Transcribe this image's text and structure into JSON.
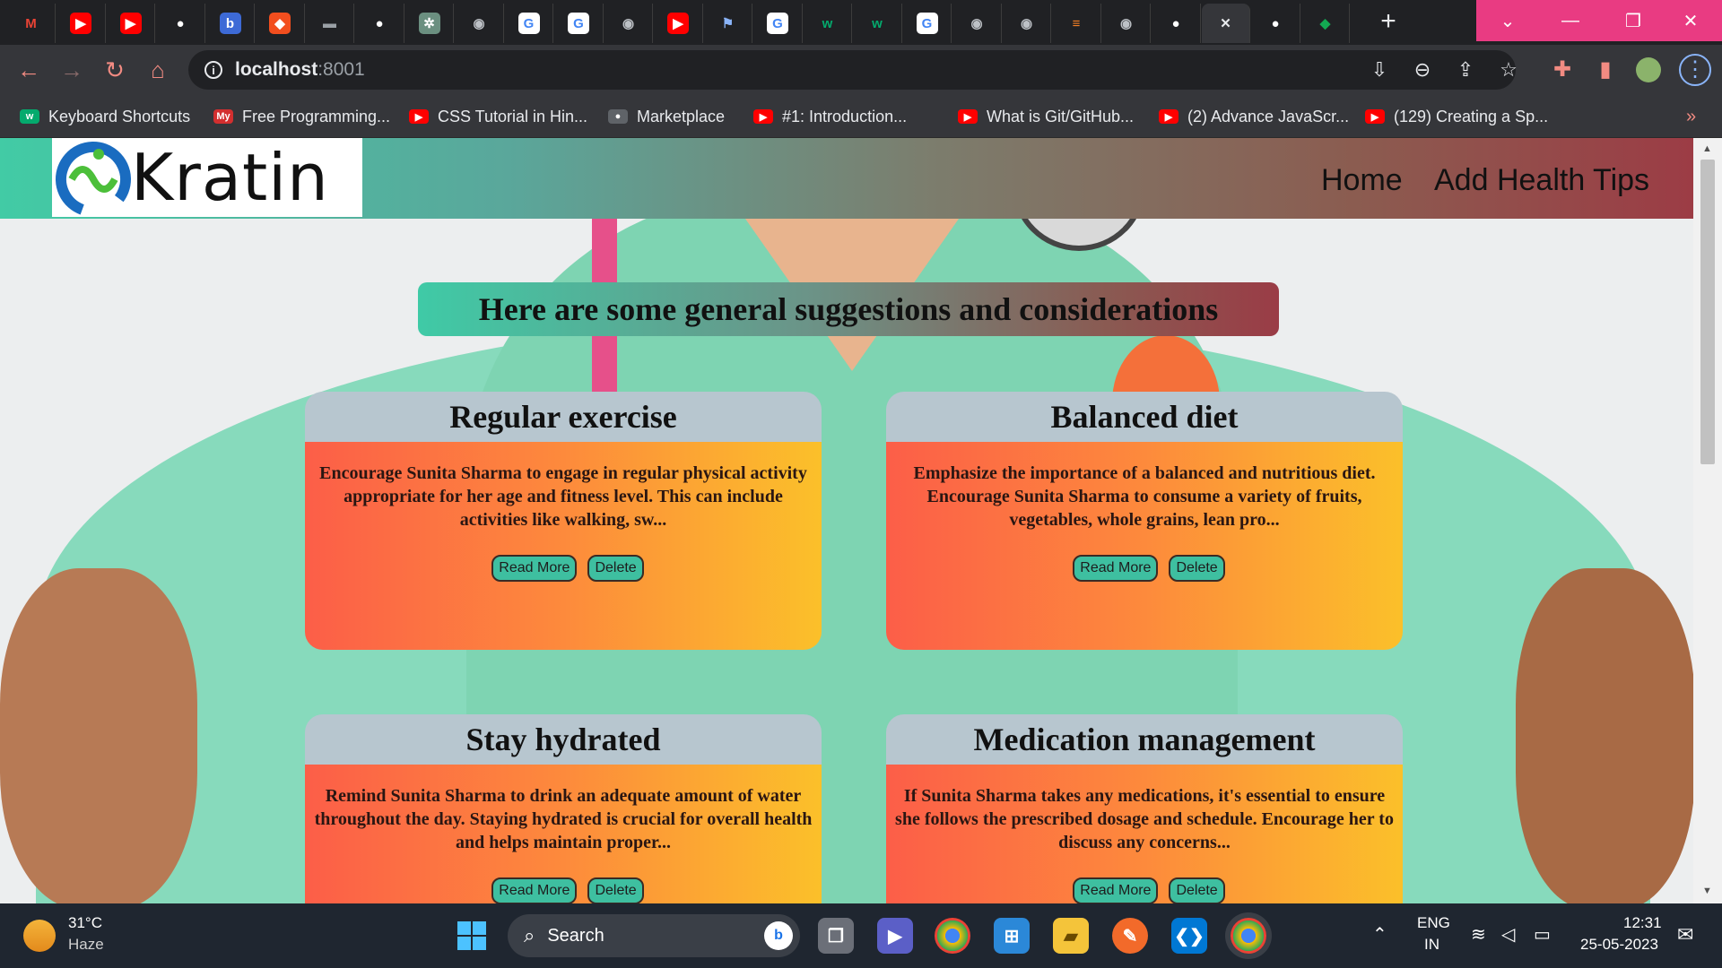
{
  "browser": {
    "tabs": [
      {
        "icon": "gmail-icon",
        "glyph": "M",
        "color": "#ea4335",
        "bg": "transparent"
      },
      {
        "icon": "youtube-icon",
        "glyph": "▶",
        "color": "#fff",
        "bg": "#ff0000"
      },
      {
        "icon": "youtube-icon",
        "glyph": "▶",
        "color": "#fff",
        "bg": "#ff0000"
      },
      {
        "icon": "github-icon",
        "glyph": "●",
        "color": "#fff",
        "bg": "transparent"
      },
      {
        "icon": "docs-icon",
        "glyph": "b",
        "color": "#fff",
        "bg": "#3d6ad6"
      },
      {
        "icon": "figma-icon",
        "glyph": "◆",
        "color": "#fff",
        "bg": "#f24e1e"
      },
      {
        "icon": "dash-icon",
        "glyph": "▬",
        "color": "#9aa0a6",
        "bg": "transparent"
      },
      {
        "icon": "github-icon",
        "glyph": "●",
        "color": "#fff",
        "bg": "transparent"
      },
      {
        "icon": "chatgpt-icon",
        "glyph": "✲",
        "color": "#fff",
        "bg": "#6b8f80"
      },
      {
        "icon": "globe-icon",
        "glyph": "◉",
        "color": "#bdc1c6",
        "bg": "transparent"
      },
      {
        "icon": "google-icon",
        "glyph": "G",
        "color": "#4285f4",
        "bg": "#fff"
      },
      {
        "icon": "google-icon",
        "glyph": "G",
        "color": "#4285f4",
        "bg": "#fff"
      },
      {
        "icon": "globe-icon",
        "glyph": "◉",
        "color": "#bdc1c6",
        "bg": "transparent"
      },
      {
        "icon": "youtube-icon",
        "glyph": "▶",
        "color": "#fff",
        "bg": "#ff0000"
      },
      {
        "icon": "flag-icon",
        "glyph": "⚑",
        "color": "#8ab4f8",
        "bg": "transparent"
      },
      {
        "icon": "google-icon",
        "glyph": "G",
        "color": "#4285f4",
        "bg": "#fff"
      },
      {
        "icon": "w3schools-icon",
        "glyph": "w",
        "color": "#04aa6d",
        "bg": "transparent"
      },
      {
        "icon": "w3schools-icon",
        "glyph": "w",
        "color": "#04aa6d",
        "bg": "transparent"
      },
      {
        "icon": "google-icon",
        "glyph": "G",
        "color": "#4285f4",
        "bg": "#fff"
      },
      {
        "icon": "globe-icon",
        "glyph": "◉",
        "color": "#bdc1c6",
        "bg": "transparent"
      },
      {
        "icon": "globe-icon",
        "glyph": "◉",
        "color": "#bdc1c6",
        "bg": "transparent"
      },
      {
        "icon": "stackoverflow-icon",
        "glyph": "≡",
        "color": "#f48024",
        "bg": "transparent"
      },
      {
        "icon": "globe-icon",
        "glyph": "◉",
        "color": "#bdc1c6",
        "bg": "transparent"
      },
      {
        "icon": "github-icon",
        "glyph": "●",
        "color": "#fff",
        "bg": "transparent"
      },
      {
        "icon": "close-icon",
        "glyph": "✕",
        "color": "#e8eaed",
        "bg": "transparent",
        "active": true
      },
      {
        "icon": "github-icon",
        "glyph": "●",
        "color": "#fff",
        "bg": "transparent"
      },
      {
        "icon": "mongodb-icon",
        "glyph": "◆",
        "color": "#13aa52",
        "bg": "transparent"
      }
    ],
    "url_host": "localhost",
    "url_port": ":8001",
    "bookmarks": [
      {
        "label": "Keyboard Shortcuts",
        "icon": "w3schools-icon",
        "color": "#04aa6d"
      },
      {
        "label": "Free Programming...",
        "icon": "my-icon",
        "color": "#d32f2f"
      },
      {
        "label": "CSS Tutorial in Hin...",
        "icon": "youtube-icon",
        "color": "#ff0000"
      },
      {
        "label": "Marketplace",
        "icon": "github-icon",
        "color": "#5f6368"
      },
      {
        "label": "#1: Introduction...",
        "icon": "youtube-icon",
        "color": "#ff0000"
      },
      {
        "label": "What is Git/GitHub...",
        "icon": "youtube-icon",
        "color": "#ff0000"
      },
      {
        "label": "(2) Advance JavaScr...",
        "icon": "youtube-icon",
        "color": "#ff0000"
      },
      {
        "label": "(129) Creating a Sp...",
        "icon": "youtube-icon",
        "color": "#ff0000"
      }
    ],
    "bookmarks_more": "»"
  },
  "site": {
    "logo_text": "Kratin",
    "nav": {
      "home": "Home",
      "add": "Add Health Tips"
    },
    "heading": "Here are some general suggestions and considerations",
    "cards": [
      {
        "title": "Regular exercise",
        "text": "Encourage Sunita Sharma to engage in regular physical activity appropriate for her age and fitness level. This can include activities like walking, sw...",
        "read_more": "Read More",
        "delete": "Delete"
      },
      {
        "title": "Balanced diet",
        "text": "Emphasize the importance of a balanced and nutritious diet. Encourage Sunita Sharma to consume a variety of fruits, vegetables, whole grains, lean pro...",
        "read_more": "Read More",
        "delete": "Delete"
      },
      {
        "title": "Stay hydrated",
        "text": "Remind Sunita Sharma to drink an adequate amount of water throughout the day. Staying hydrated is crucial for overall health and helps maintain proper...",
        "read_more": "Read More",
        "delete": "Delete"
      },
      {
        "title": "Medication management",
        "text": "If Sunita Sharma takes any medications, it's essential to ensure she follows the prescribed dosage and schedule. Encourage her to discuss any concerns...",
        "read_more": "Read More",
        "delete": "Delete"
      }
    ]
  },
  "taskbar": {
    "weather_temp": "31°C",
    "weather_desc": "Haze",
    "search_placeholder": "Search",
    "lang_top": "ENG",
    "lang_bottom": "IN",
    "time": "12:31",
    "date": "25-05-2023"
  },
  "colors": {
    "accent": "#e93b82",
    "card_header": "#b7c6cf",
    "button": "#3ebfa0"
  }
}
